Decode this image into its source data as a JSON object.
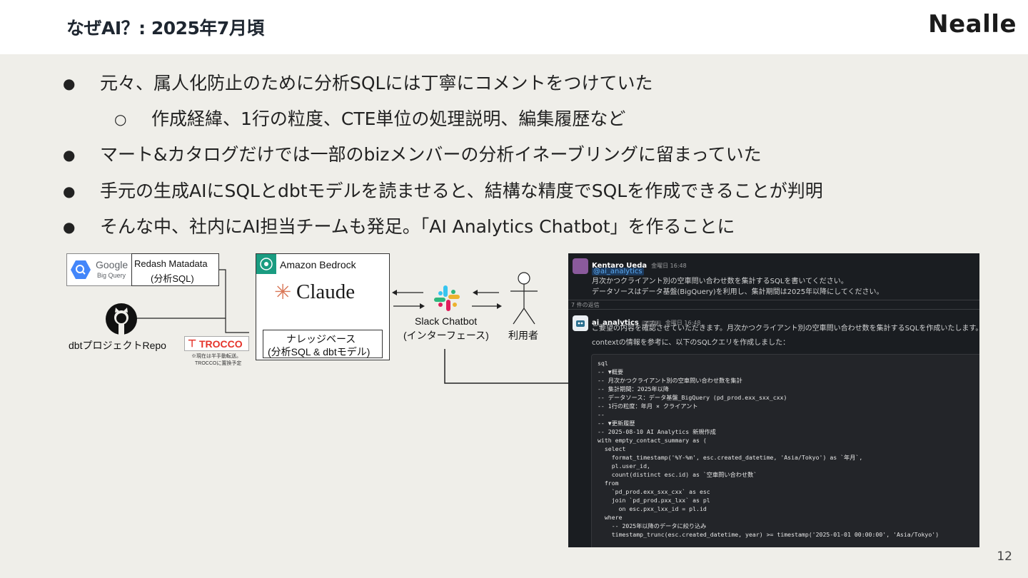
{
  "header": {
    "title": "なぜAI？: 2025年7月頃",
    "brand": "Nealle"
  },
  "bullets": [
    {
      "text": "元々、属人化防止のために分析SQLには丁寧にコメントをつけていた",
      "marker": "●"
    },
    {
      "text": "作成経緯、1行の粒度、CTE単位の処理説明、編集履歴など",
      "marker": "○"
    },
    {
      "text": "マート&カタログだけでは一部のbizメンバーの分析イネーブリングに留まっていた",
      "marker": "●"
    },
    {
      "text": "手元の生成AIにSQLとdbtモデルを読ませると、結構な精度でSQLを作成できることが判明",
      "marker": "●"
    },
    {
      "text": "そんな中、社内にAI担当チームも発足。「AI Analytics Chatbot」を作ることに",
      "marker": "●"
    }
  ],
  "diagram": {
    "bigquery_logo_line1": "Google",
    "bigquery_logo_line2": "Big Query",
    "redash_line1": "Redash Matadata",
    "redash_line2": "(分析SQL)",
    "dbt_label": "dbtプロジェクトRepo",
    "trocco_logo": "TROCCO",
    "trocco_note_line1": "※現在は半手動転送。",
    "trocco_note_line2": "TROCCOに置換予定",
    "bedrock_label": "Amazon Bedrock",
    "claude_label": "Claude",
    "knowledge_line1": "ナレッジベース",
    "knowledge_line2": "(分析SQL & dbtモデル)",
    "slack_line1": "Slack Chatbot",
    "slack_line2": "(インターフェース)",
    "user_label": "利用者"
  },
  "slack": {
    "user_name": "Kentaro Ueda",
    "user_time": "金曜日 16:48",
    "mention": "@ai_analytics",
    "user_msg_line1": "月次かつクライアント別の空車問い合わせ数を集計するSQLを書いてください。",
    "user_msg_line2": "データソースはデータ基盤(BigQuery)を利用し、集計期間は2025年以降にしてください。",
    "replies": "7 件の返信",
    "bot_name": "ai_analytics",
    "bot_tag": "アプリ",
    "bot_time": "金曜日 16:48",
    "bot_msg_line1": "ご要望の内容を確認させていただきます。月次かつクライアント別の空車問い合わせ数を集計するSQLを作成いたします。",
    "bot_msg_line2": "contextの情報を参考に、以下のSQLクエリを作成しました：",
    "code_lines": [
      "sql",
      "-- ▼概要",
      "-- 月次かつクライアント別の空車問い合わせ数を集計",
      "-- 集計期間：2025年以降",
      "-- データソース：データ基盤_BigQuery (pd_prod.exx_sxx_cxx)",
      "-- 1行の粒度：年月 × クライアント",
      "--",
      "-- ▼更新履歴",
      "-- 2025-08-10 AI Analytics 新規作成",
      "",
      "with empty_contact_summary as (",
      "  select",
      "    format_timestamp('%Y-%m', esc.created_datetime, 'Asia/Tokyo') as `年月`,",
      "    pl.user_id,",
      "    count(distinct esc.id) as `空車問い合わせ数`",
      "  from",
      "    `pd_prod.exx_sxx_cxx` as esc",
      "    join `pd_prod.pxx_lxx` as pl",
      "      on esc.pxx_lxx_id = pl.id",
      "  where",
      "    -- 2025年以降のデータに絞り込み",
      "    timestamp_trunc(esc.created_datetime, year) >= timestamp('2025-01-01 00:00:00', 'Asia/Tokyo')"
    ]
  },
  "page_number": "12",
  "colors": {
    "background": "#efeee9",
    "header_bg": "#ffffff",
    "slack_bg": "#1a1d21",
    "trocco_red": "#e5332a",
    "claude_orange": "#d97757"
  }
}
